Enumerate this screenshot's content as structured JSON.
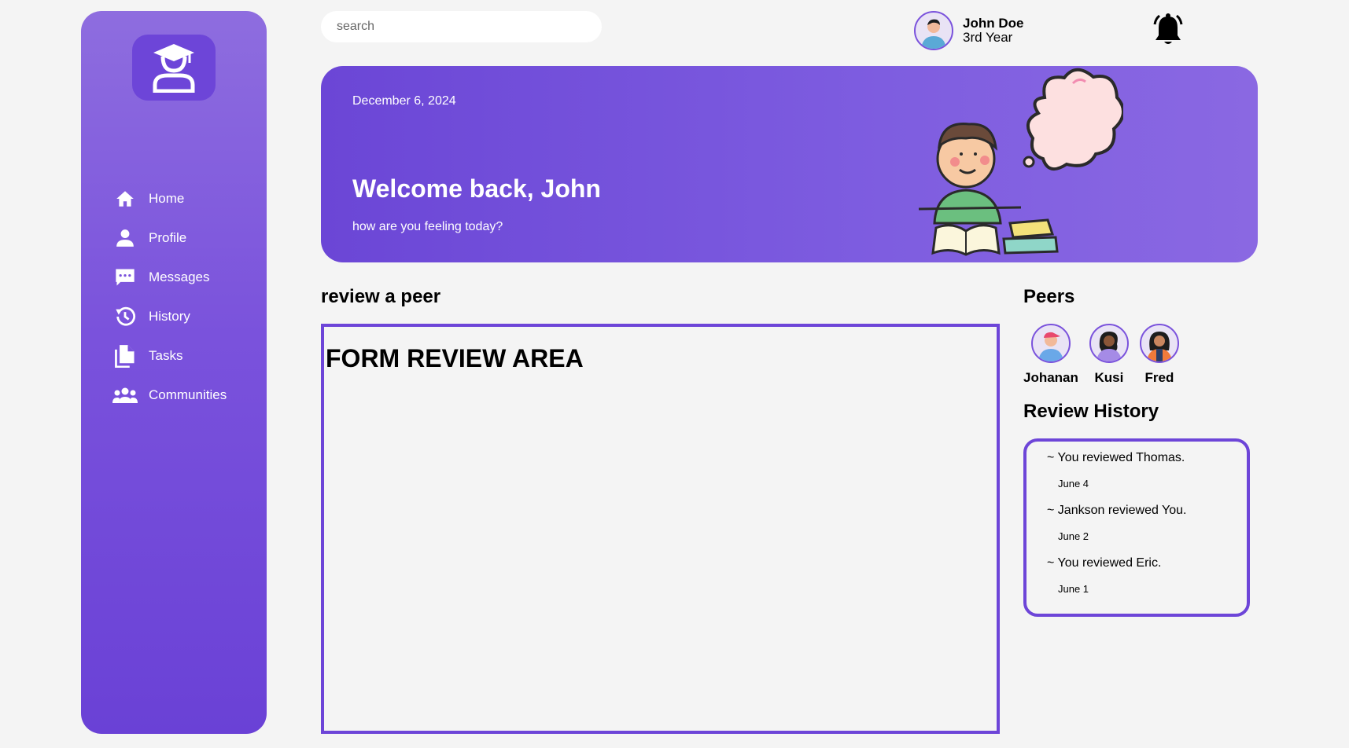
{
  "colors": {
    "accent": "#6d45d8",
    "sidebar_top": "#8e6ddf",
    "sidebar_bottom": "#6a41d6",
    "background": "#f4f4f4"
  },
  "sidebar": {
    "logo_icon": "graduate-student-icon",
    "items": [
      {
        "label": "Home",
        "icon": "home-icon"
      },
      {
        "label": "Profile",
        "icon": "user-icon"
      },
      {
        "label": "Messages",
        "icon": "chat-icon"
      },
      {
        "label": "History",
        "icon": "history-icon"
      },
      {
        "label": "Tasks",
        "icon": "document-icon"
      },
      {
        "label": "Communities",
        "icon": "group-icon"
      }
    ]
  },
  "header": {
    "search_placeholder": "search",
    "user": {
      "name": "John Doe",
      "year": "3rd Year"
    },
    "bell_icon": "bell-icon"
  },
  "banner": {
    "date": "December 6, 2024",
    "title": "Welcome back, John",
    "subtitle": "how are you feeling today?"
  },
  "review": {
    "title": "review a peer",
    "form_label": "FORM REVIEW AREA"
  },
  "peers": {
    "title": "Peers",
    "list": [
      {
        "name": "Johanan"
      },
      {
        "name": "Kusi"
      },
      {
        "name": "Fred"
      }
    ]
  },
  "history": {
    "title": "Review History",
    "items": [
      {
        "text": "~ You reviewed Thomas.",
        "date": "June 4"
      },
      {
        "text": "~ Jankson reviewed You.",
        "date": "June 2"
      },
      {
        "text": "~ You reviewed Eric.",
        "date": "June 1"
      }
    ]
  }
}
